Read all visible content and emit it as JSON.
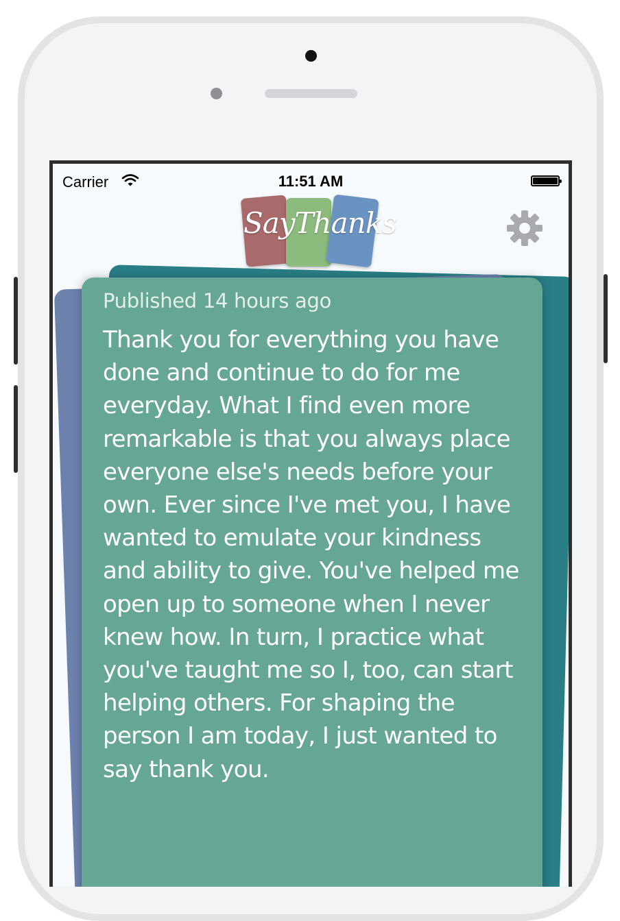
{
  "status_bar": {
    "carrier": "Carrier",
    "time": "11:51 AM"
  },
  "header": {
    "logo_text": "SayThanks",
    "logo_colors": [
      "#a86a6a",
      "#8dba7d",
      "#6a93c2"
    ],
    "settings_icon": "gear-icon"
  },
  "card": {
    "published": "Published 14 hours ago",
    "message": "Thank you for everything you have done and continue to do for me everyday. What I find even more remarkable is that you always place everyone else's needs before your own. Ever since I've met you, I have wanted to emulate your kindness and ability to give. You've helped me open up to someone when I never knew how. In turn, I practice what you've taught me so I, too, can start helping others. For shaping the person I am today, I just wanted to say thank you.",
    "front_color": "#66a694",
    "back_colors": [
      "#6c82ad",
      "#2a7e86"
    ]
  }
}
